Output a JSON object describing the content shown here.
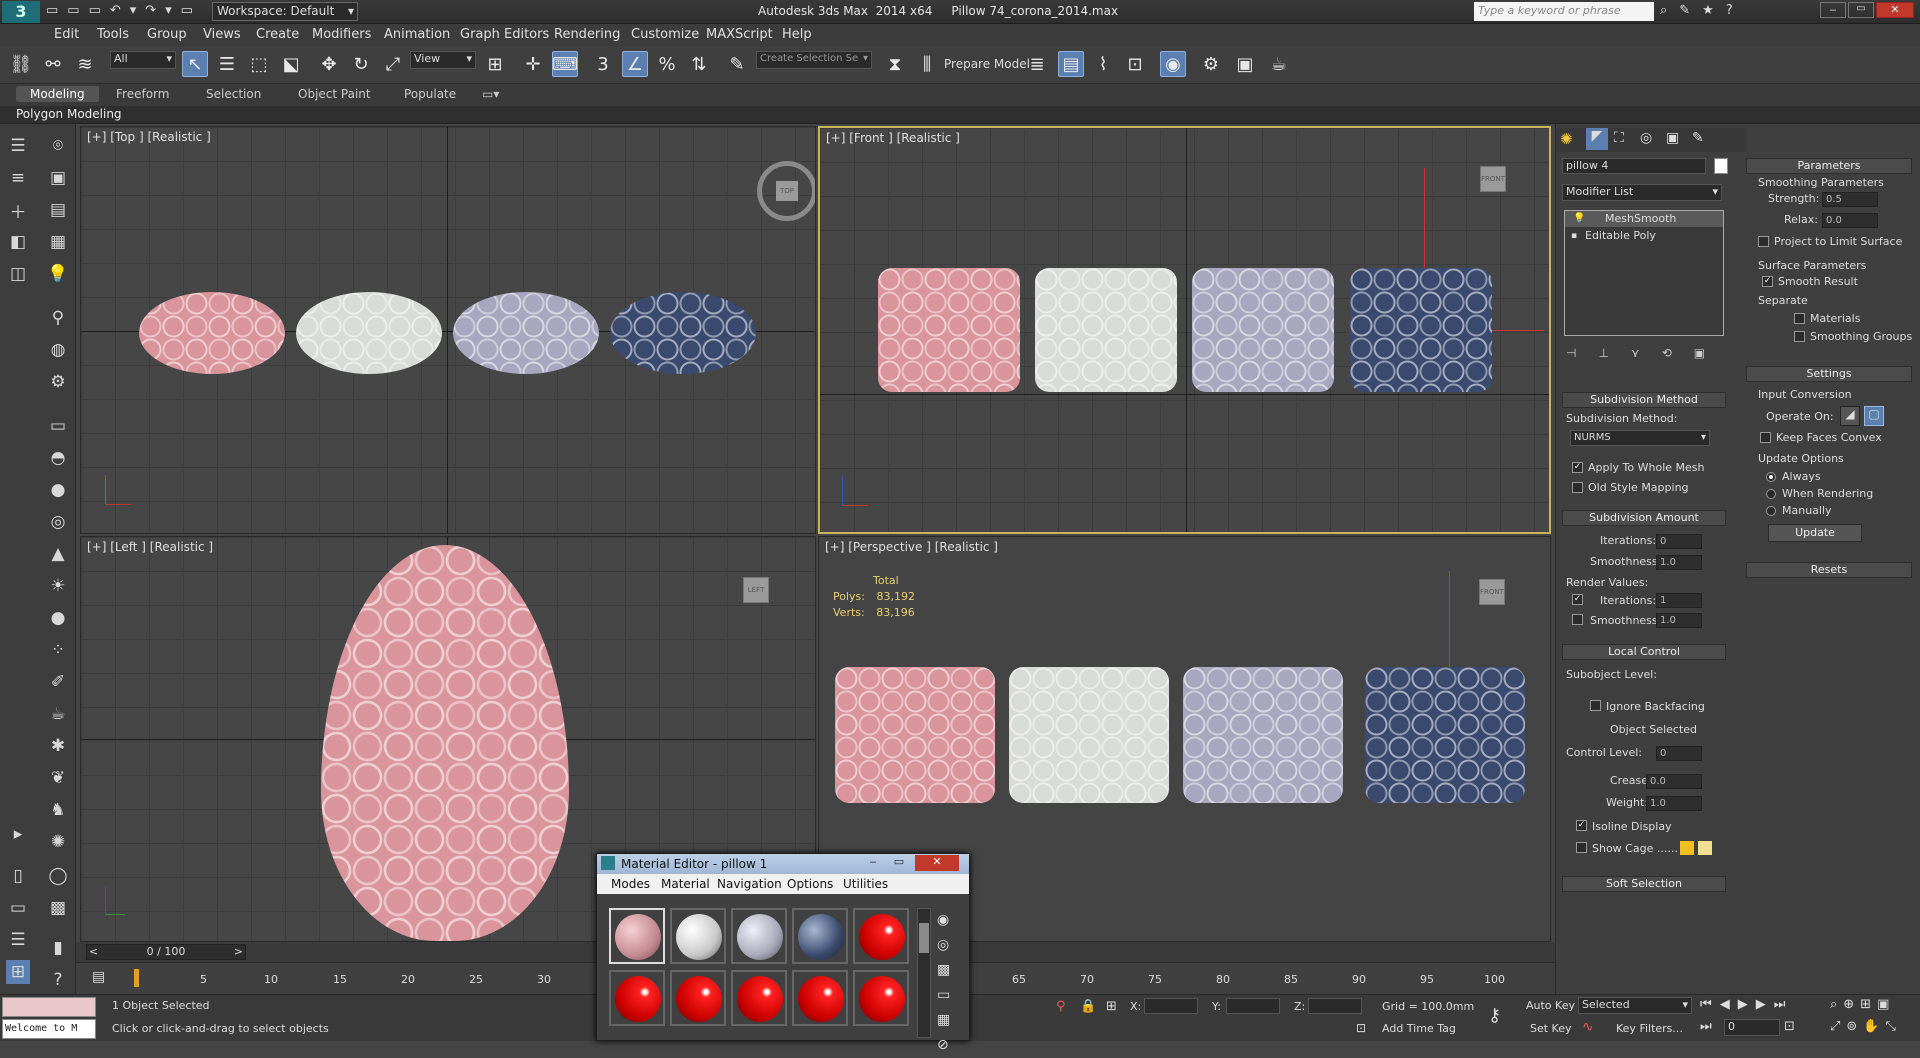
{
  "app": {
    "title": "Autodesk 3ds Max  2014 x64     Pillow 74_corona_2014.max",
    "workspace": "Workspace: Default",
    "search_placeholder": "Type a keyword or phrase"
  },
  "menu": [
    "Edit",
    "Tools",
    "Group",
    "Views",
    "Create",
    "Modifiers",
    "Animation",
    "Graph Editors",
    "Rendering",
    "Customize",
    "MAXScript",
    "Help"
  ],
  "toolbar": {
    "filter": "All",
    "refcoord": "View",
    "selection_set": "Create Selection Se",
    "prepare_model": "Prepare Model"
  },
  "ribbon": {
    "tabs": [
      "Modeling",
      "Freeform",
      "Selection",
      "Object Paint",
      "Populate"
    ],
    "sub_label": "Polygon Modeling"
  },
  "viewports": {
    "top": "[+] [Top ] [Realistic ]",
    "front": "[+] [Front ] [Realistic ]",
    "left": "[+] [Left ] [Realistic ]",
    "perspective": "[+] [Perspective ] [Realistic ]",
    "stats": {
      "total": "Total",
      "polys_label": "Polys:",
      "polys": "83,192",
      "verts_label": "Verts:",
      "verts": "83,196"
    },
    "cube_top": "TOP",
    "cube_front": "FRONT",
    "cube_left": "LEFT"
  },
  "pillow_colors": [
    "#d9949c",
    "#d8dcd8",
    "#a9a6bf",
    "#3a4a6e"
  ],
  "command_panel": {
    "object_name": "pillow 4",
    "modifier_list": "Modifier List",
    "stack": [
      "MeshSmooth",
      "Editable Poly"
    ],
    "subdivision_method": {
      "title": "Subdivision Method",
      "method_label": "Subdivision Method:",
      "method": "NURMS",
      "apply_whole": "Apply To Whole Mesh",
      "old_style": "Old Style Mapping"
    },
    "subdivision_amount": {
      "title": "Subdivision Amount",
      "iterations_label": "Iterations:",
      "iterations": "0",
      "smoothness_label": "Smoothness:",
      "smoothness": "1.0",
      "render_values": "Render Values:",
      "r_iterations": "1",
      "r_smoothness": "1.0"
    },
    "local_control": {
      "title": "Local Control",
      "subobject_level": "Subobject Level:",
      "ignore_backfacing": "Ignore Backfacing",
      "object_selected": "Object Selected",
      "control_level": "Control Level:",
      "control_value": "0",
      "crease_label": "Crease:",
      "crease": "0.0",
      "weight_label": "Weight:",
      "weight": "1.0",
      "isoline": "Isoline Display",
      "show_cage": "Show Cage ......"
    },
    "soft_selection": "Soft Selection",
    "parameters": {
      "title": "Parameters",
      "smoothing": "Smoothing Parameters",
      "strength_label": "Strength:",
      "strength": "0.5",
      "relax_label": "Relax:",
      "relax": "0.0",
      "project": "Project to Limit Surface",
      "surface": "Surface Parameters",
      "smooth_result": "Smooth Result",
      "separate": "Separate",
      "materials": "Materials",
      "smoothing_groups": "Smoothing Groups"
    },
    "settings": {
      "title": "Settings",
      "input_conversion": "Input Conversion",
      "operate_on": "Operate On:",
      "keep_convex": "Keep Faces Convex",
      "update_options": "Update Options",
      "always": "Always",
      "when_rendering": "When Rendering",
      "manually": "Manually",
      "update": "Update"
    },
    "resets": "Resets"
  },
  "material_editor": {
    "title": "Material Editor - pillow 1",
    "menu": [
      "Modes",
      "Material",
      "Navigation",
      "Options",
      "Utilities"
    ]
  },
  "timeline": {
    "frame": "0 / 100",
    "ticks": [
      "5",
      "10",
      "15",
      "20",
      "25",
      "30",
      "65",
      "70",
      "75",
      "80",
      "85",
      "90",
      "95",
      "100"
    ]
  },
  "status": {
    "maxscript": "Welcome to M",
    "selected": "1 Object Selected",
    "prompt": "Click or click-and-drag to select objects",
    "x": "X:",
    "y": "Y:",
    "z": "Z:",
    "grid": "Grid = 100.0mm",
    "add_time_tag": "Add Time Tag",
    "auto_key": "Auto Key",
    "set_key": "Set Key",
    "key_mode": "Selected",
    "key_filters": "Key Filters...",
    "frame_value": "0"
  }
}
